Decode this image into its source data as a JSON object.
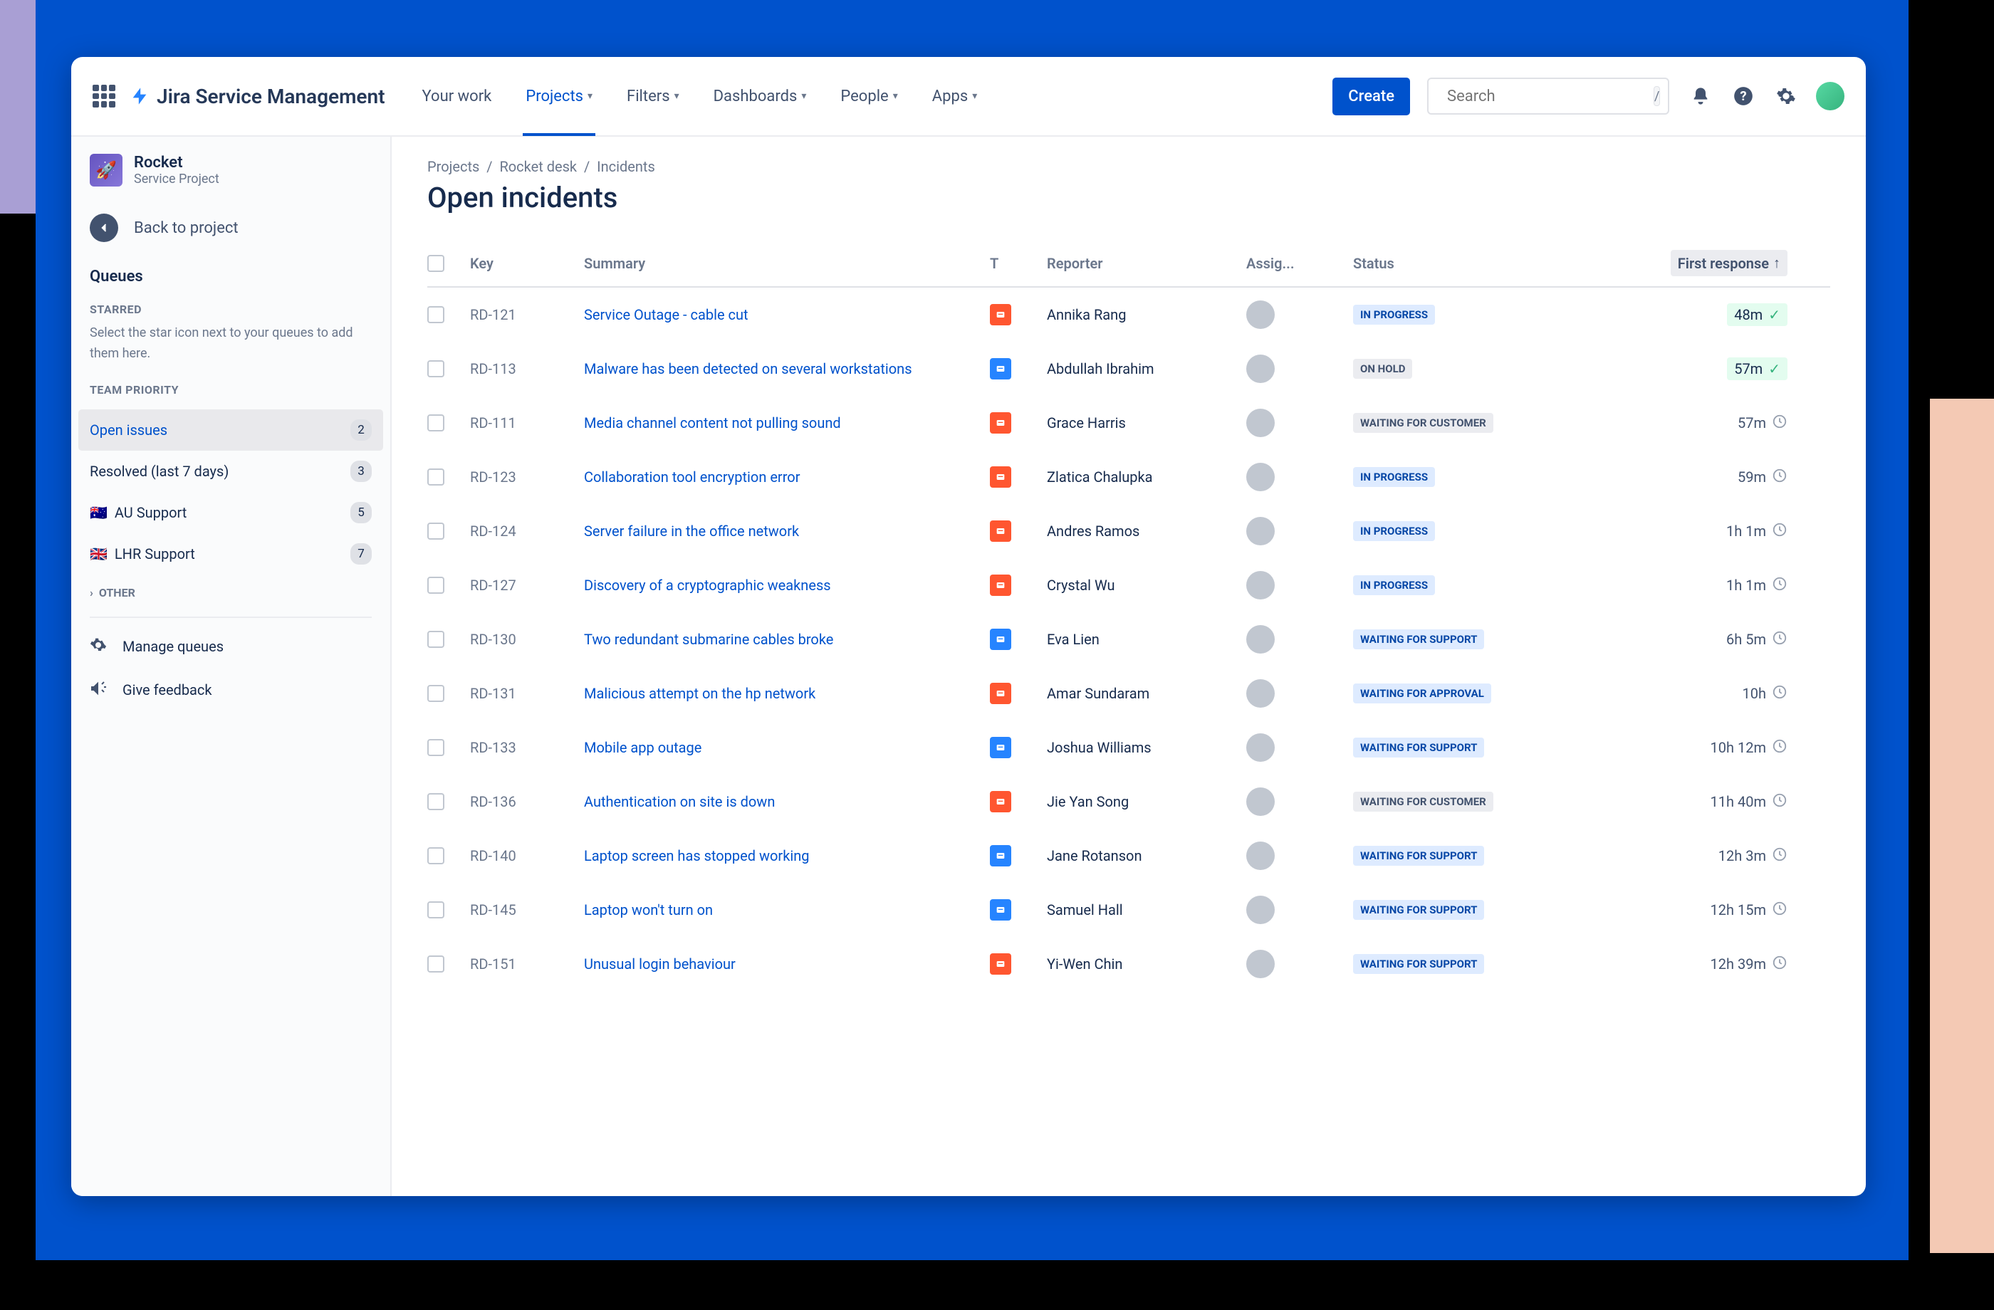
{
  "product": "Jira Service Management",
  "nav": {
    "your_work": "Your work",
    "projects": "Projects",
    "filters": "Filters",
    "dashboards": "Dashboards",
    "people": "People",
    "apps": "Apps",
    "create": "Create",
    "search_placeholder": "Search"
  },
  "sidebar": {
    "project_name": "Rocket",
    "project_sub": "Service Project",
    "back": "Back to project",
    "queues": "Queues",
    "starred_label": "STARRED",
    "starred_note": "Select the star icon next to your queues to add them here.",
    "team_priority_label": "TEAM PRIORITY",
    "queue_items": [
      {
        "label": "Open issues",
        "count": "2",
        "selected": true
      },
      {
        "label": "Resolved (last 7 days)",
        "count": "3"
      },
      {
        "label": "AU Support",
        "count": "5",
        "flag": "🇦🇺"
      },
      {
        "label": "LHR Support",
        "count": "7",
        "flag": "🇬🇧"
      }
    ],
    "other_label": "OTHER",
    "manage": "Manage queues",
    "feedback": "Give feedback"
  },
  "crumbs": {
    "projects": "Projects",
    "desk": "Rocket desk",
    "incidents": "Incidents"
  },
  "page_title": "Open incidents",
  "columns": {
    "key": "Key",
    "summary": "Summary",
    "t": "T",
    "reporter": "Reporter",
    "assignee": "Assig...",
    "status": "Status",
    "first_response": "First response"
  },
  "status_labels": {
    "IN_PROGRESS": "IN PROGRESS",
    "ON_HOLD": "ON HOLD",
    "WAITING_FOR_CUSTOMER": "WAITING FOR CUSTOMER",
    "WAITING_FOR_SUPPORT": "WAITING FOR SUPPORT",
    "WAITING_FOR_APPROVAL": "WAITING FOR APPROVAL"
  },
  "rows": [
    {
      "key": "RD-121",
      "summary": "Service Outage - cable cut",
      "type": "orange",
      "reporter": "Annika Rang",
      "status": "IN_PROGRESS",
      "fr": "48m",
      "fr_state": "met"
    },
    {
      "key": "RD-113",
      "summary": "Malware has been detected on several workstations",
      "type": "blue",
      "reporter": "Abdullah Ibrahim",
      "status": "ON_HOLD",
      "fr": "57m",
      "fr_state": "met"
    },
    {
      "key": "RD-111",
      "summary": "Media channel content not pulling sound",
      "type": "orange",
      "reporter": "Grace Harris",
      "status": "WAITING_FOR_CUSTOMER",
      "fr": "57m",
      "fr_state": "clock"
    },
    {
      "key": "RD-123",
      "summary": "Collaboration tool encryption error",
      "type": "orange",
      "reporter": "Zlatica Chalupka",
      "status": "IN_PROGRESS",
      "fr": "59m",
      "fr_state": "clock"
    },
    {
      "key": "RD-124",
      "summary": "Server failure in the office network",
      "type": "orange",
      "reporter": "Andres Ramos",
      "status": "IN_PROGRESS",
      "fr": "1h 1m",
      "fr_state": "clock"
    },
    {
      "key": "RD-127",
      "summary": "Discovery of a cryptographic weakness",
      "type": "orange",
      "reporter": "Crystal Wu",
      "status": "IN_PROGRESS",
      "fr": "1h 1m",
      "fr_state": "clock"
    },
    {
      "key": "RD-130",
      "summary": "Two redundant submarine cables broke",
      "type": "blue",
      "reporter": "Eva Lien",
      "status": "WAITING_FOR_SUPPORT",
      "fr": "6h 5m",
      "fr_state": "clock"
    },
    {
      "key": "RD-131",
      "summary": "Malicious attempt on the hp network",
      "type": "orange",
      "reporter": "Amar Sundaram",
      "status": "WAITING_FOR_APPROVAL",
      "fr": "10h",
      "fr_state": "clock"
    },
    {
      "key": "RD-133",
      "summary": "Mobile app outage",
      "type": "blue",
      "reporter": "Joshua Williams",
      "status": "WAITING_FOR_SUPPORT",
      "fr": "10h 12m",
      "fr_state": "clock"
    },
    {
      "key": "RD-136",
      "summary": "Authentication on site is down",
      "type": "orange",
      "reporter": "Jie Yan Song",
      "status": "WAITING_FOR_CUSTOMER",
      "fr": "11h 40m",
      "fr_state": "clock"
    },
    {
      "key": "RD-140",
      "summary": "Laptop screen has stopped working",
      "type": "blue",
      "reporter": "Jane Rotanson",
      "status": "WAITING_FOR_SUPPORT",
      "fr": "12h 3m",
      "fr_state": "clock"
    },
    {
      "key": "RD-145",
      "summary": "Laptop won't turn on",
      "type": "blue",
      "reporter": "Samuel Hall",
      "status": "WAITING_FOR_SUPPORT",
      "fr": "12h 15m",
      "fr_state": "clock"
    },
    {
      "key": "RD-151",
      "summary": "Unusual login behaviour",
      "type": "orange",
      "reporter": "Yi-Wen Chin",
      "status": "WAITING_FOR_SUPPORT",
      "fr": "12h 39m",
      "fr_state": "clock"
    }
  ]
}
